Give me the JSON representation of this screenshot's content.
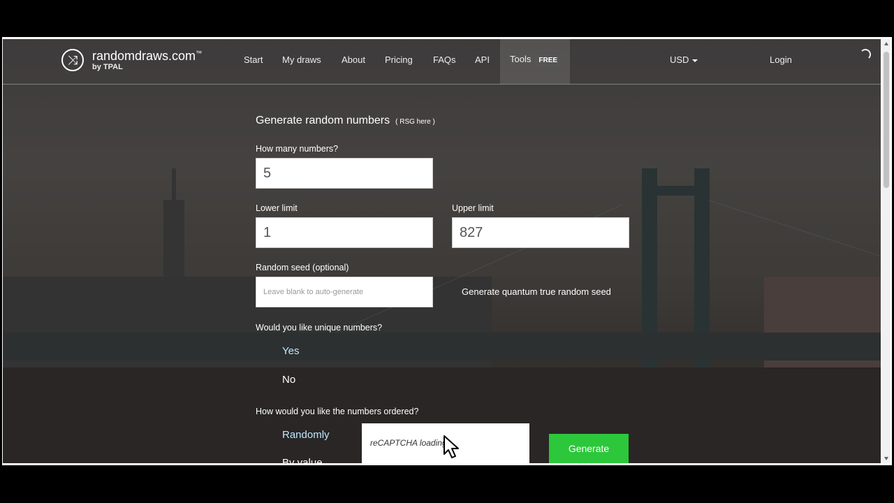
{
  "nav": {
    "logo_name": "randomdraws.com",
    "logo_tm": "™",
    "logo_sub": "by TPAL",
    "items": [
      "Start",
      "My draws",
      "About",
      "Pricing",
      "FAQs",
      "API"
    ],
    "tools": "Tools",
    "free_badge": "FREE",
    "currency": "USD",
    "login": "Login"
  },
  "form": {
    "title": "Generate random numbers",
    "rsg_link": "( RSG here )",
    "how_many_label": "How many numbers?",
    "how_many_value": "5",
    "lower_label": "Lower limit",
    "lower_value": "1",
    "upper_label": "Upper limit",
    "upper_value": "827",
    "seed_label": "Random seed (optional)",
    "seed_placeholder": "Leave blank to auto-generate",
    "quantum_link": "Generate quantum true random seed",
    "unique_question": "Would you like unique numbers?",
    "unique_options": [
      "Yes",
      "No"
    ],
    "order_question": "How would you like the numbers ordered?",
    "order_options": [
      "Randomly",
      "By value"
    ],
    "captcha_text": "reCAPTCHA loading...",
    "generate_button": "Generate"
  },
  "colors": {
    "generate_green": "#2cc73a",
    "selected_option": "#bfe6ff"
  }
}
